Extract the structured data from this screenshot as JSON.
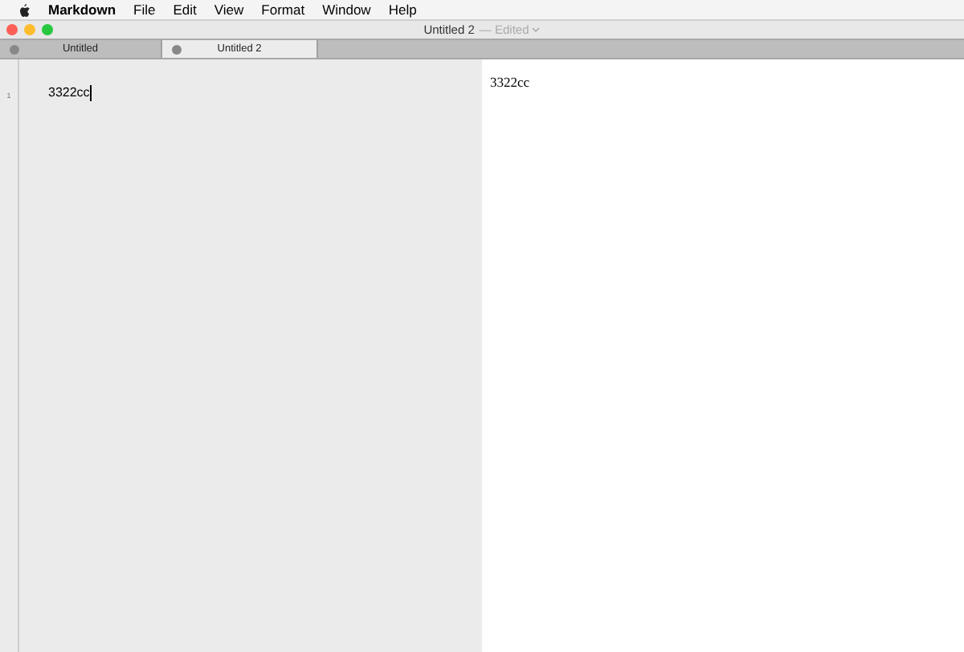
{
  "menu_bar": {
    "app_name": "Markdown",
    "items": [
      "File",
      "Edit",
      "View",
      "Format",
      "Window",
      "Help"
    ]
  },
  "window": {
    "title": "Untitled 2",
    "status": "— Edited"
  },
  "tabs": [
    {
      "label": "Untitled",
      "selected": false
    },
    {
      "label": "Untitled 2",
      "selected": true
    }
  ],
  "editor": {
    "lines": [
      {
        "number": "1",
        "text": "3322cc",
        "cursor": true
      }
    ]
  },
  "preview": {
    "paragraphs": [
      "3322cc"
    ]
  }
}
